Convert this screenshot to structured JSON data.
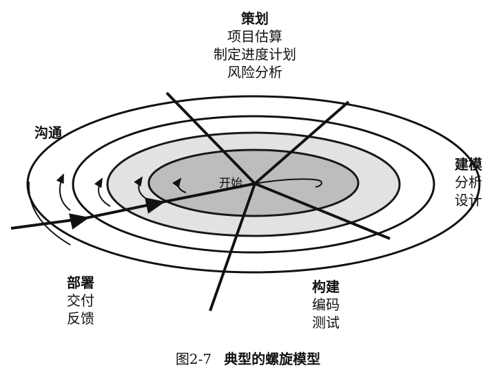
{
  "quadrants": {
    "planning": {
      "title": "策划",
      "lines": [
        "项目估算",
        "制定进度计划",
        "风险分析"
      ]
    },
    "communication": {
      "title": "沟通",
      "lines": []
    },
    "modeling": {
      "title": "建模",
      "lines": [
        "分析",
        "设计"
      ]
    },
    "construction": {
      "title": "构建",
      "lines": [
        "编码",
        "测试"
      ]
    },
    "deployment": {
      "title": "部署",
      "lines": [
        "交付",
        "反馈"
      ]
    }
  },
  "center_label": "开始",
  "caption": {
    "figure": "图2-7",
    "text": "典型的螺旋模型"
  },
  "colors": {
    "ink": "#111111",
    "inner_fill": "#bdbdbd",
    "mid_fill": "#e3e3e3"
  }
}
